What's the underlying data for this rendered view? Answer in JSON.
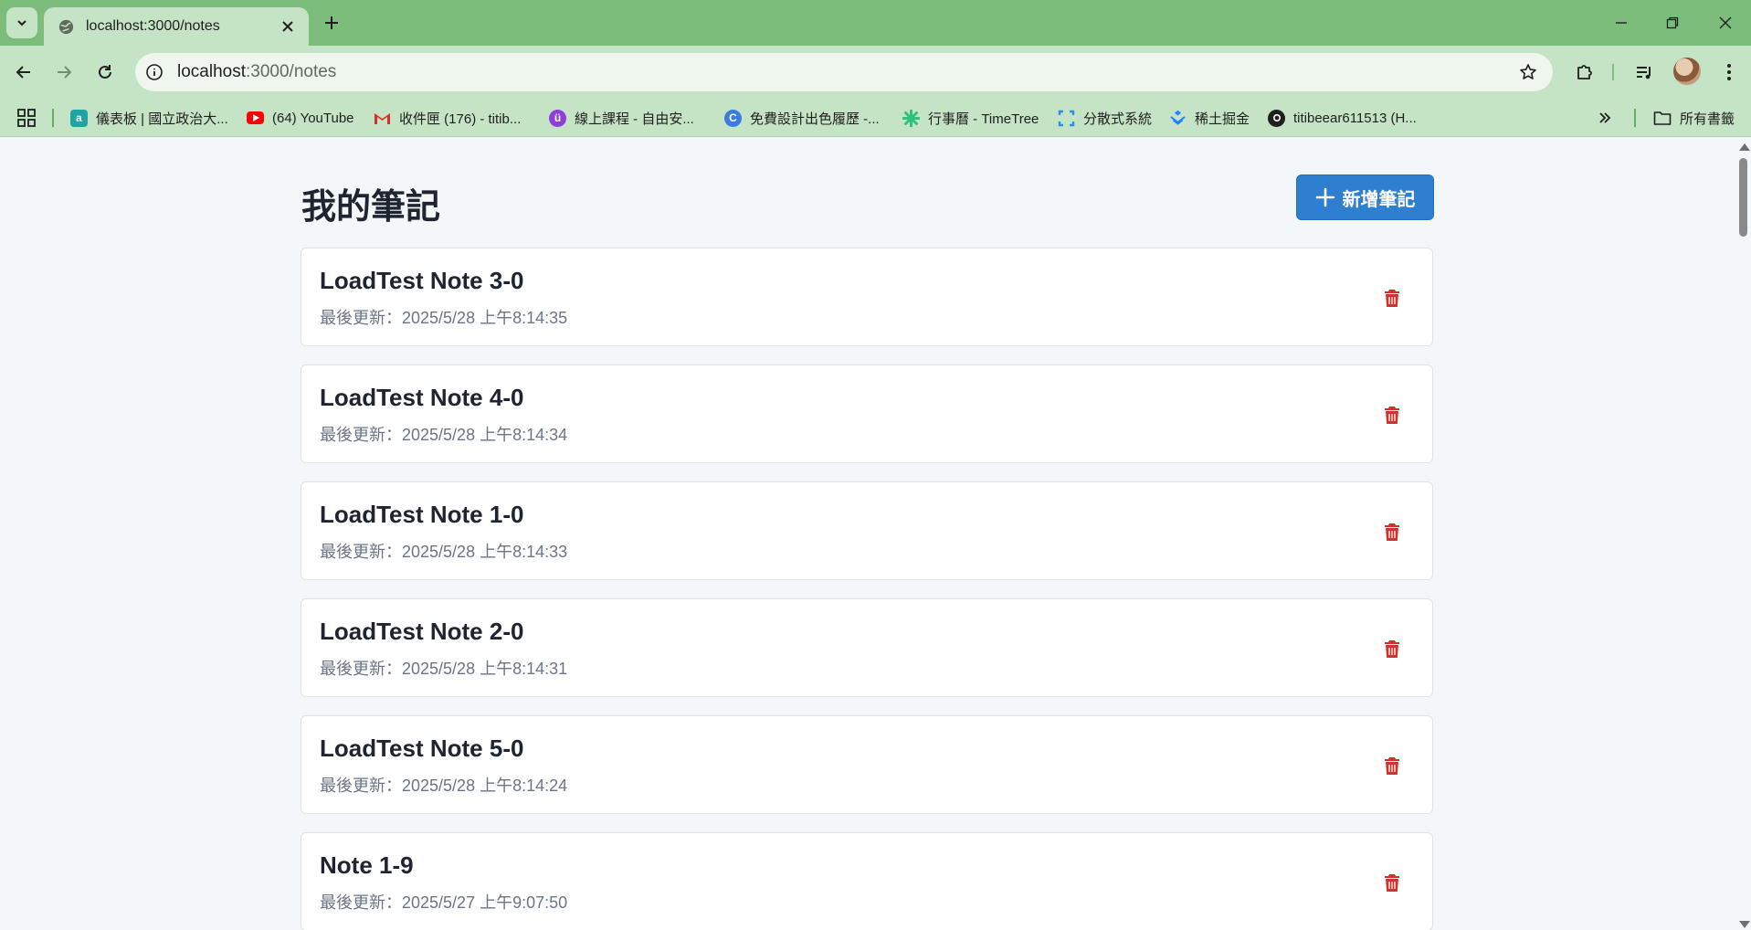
{
  "browser": {
    "tab_title": "localhost:3000/notes",
    "url_host": "localhost",
    "url_path": ":3000/notes",
    "bookmarks": [
      {
        "label": "儀表板 | 國立政治大...",
        "icon": "moodle-icon",
        "color": "#1fa3a3"
      },
      {
        "label": "(64) YouTube",
        "icon": "youtube-icon",
        "color": "#ff0000"
      },
      {
        "label": "收件匣 (176) - titib...",
        "icon": "gmail-icon",
        "color": "#d93025"
      },
      {
        "label": "線上課程 - 自由安...",
        "icon": "course-icon",
        "color": "#8e3fd9"
      },
      {
        "label": "免費設計出色履歷 -...",
        "icon": "canva-icon",
        "color": "#3d7be0"
      },
      {
        "label": "行事曆 - TimeTree",
        "icon": "timetree-icon",
        "color": "#2ec27e"
      },
      {
        "label": "分散式系統",
        "icon": "bracket-icon",
        "color": "#2f8fe8"
      },
      {
        "label": "稀土掘金",
        "icon": "juejin-icon",
        "color": "#1e80ff"
      },
      {
        "label": "titibeear611513 (H...",
        "icon": "github-icon",
        "color": "#1f1f1f"
      }
    ],
    "all_bookmarks_label": "所有書籤"
  },
  "page": {
    "title": "我的筆記",
    "new_note_label": "新增筆記"
  },
  "notes": [
    {
      "title": "LoadTest Note 3-0",
      "meta": "最後更新：2025/5/28 上午8:14:35"
    },
    {
      "title": "LoadTest Note 4-0",
      "meta": "最後更新：2025/5/28 上午8:14:34"
    },
    {
      "title": "LoadTest Note 1-0",
      "meta": "最後更新：2025/5/28 上午8:14:33"
    },
    {
      "title": "LoadTest Note 2-0",
      "meta": "最後更新：2025/5/28 上午8:14:31"
    },
    {
      "title": "LoadTest Note 5-0",
      "meta": "最後更新：2025/5/28 上午8:14:24"
    },
    {
      "title": "Note 1-9",
      "meta": "最後更新：2025/5/27 上午9:07:50"
    }
  ],
  "colors": {
    "accent": "#2f7fd0",
    "delete": "#d0312d",
    "chrome": "#7cbd7c"
  }
}
